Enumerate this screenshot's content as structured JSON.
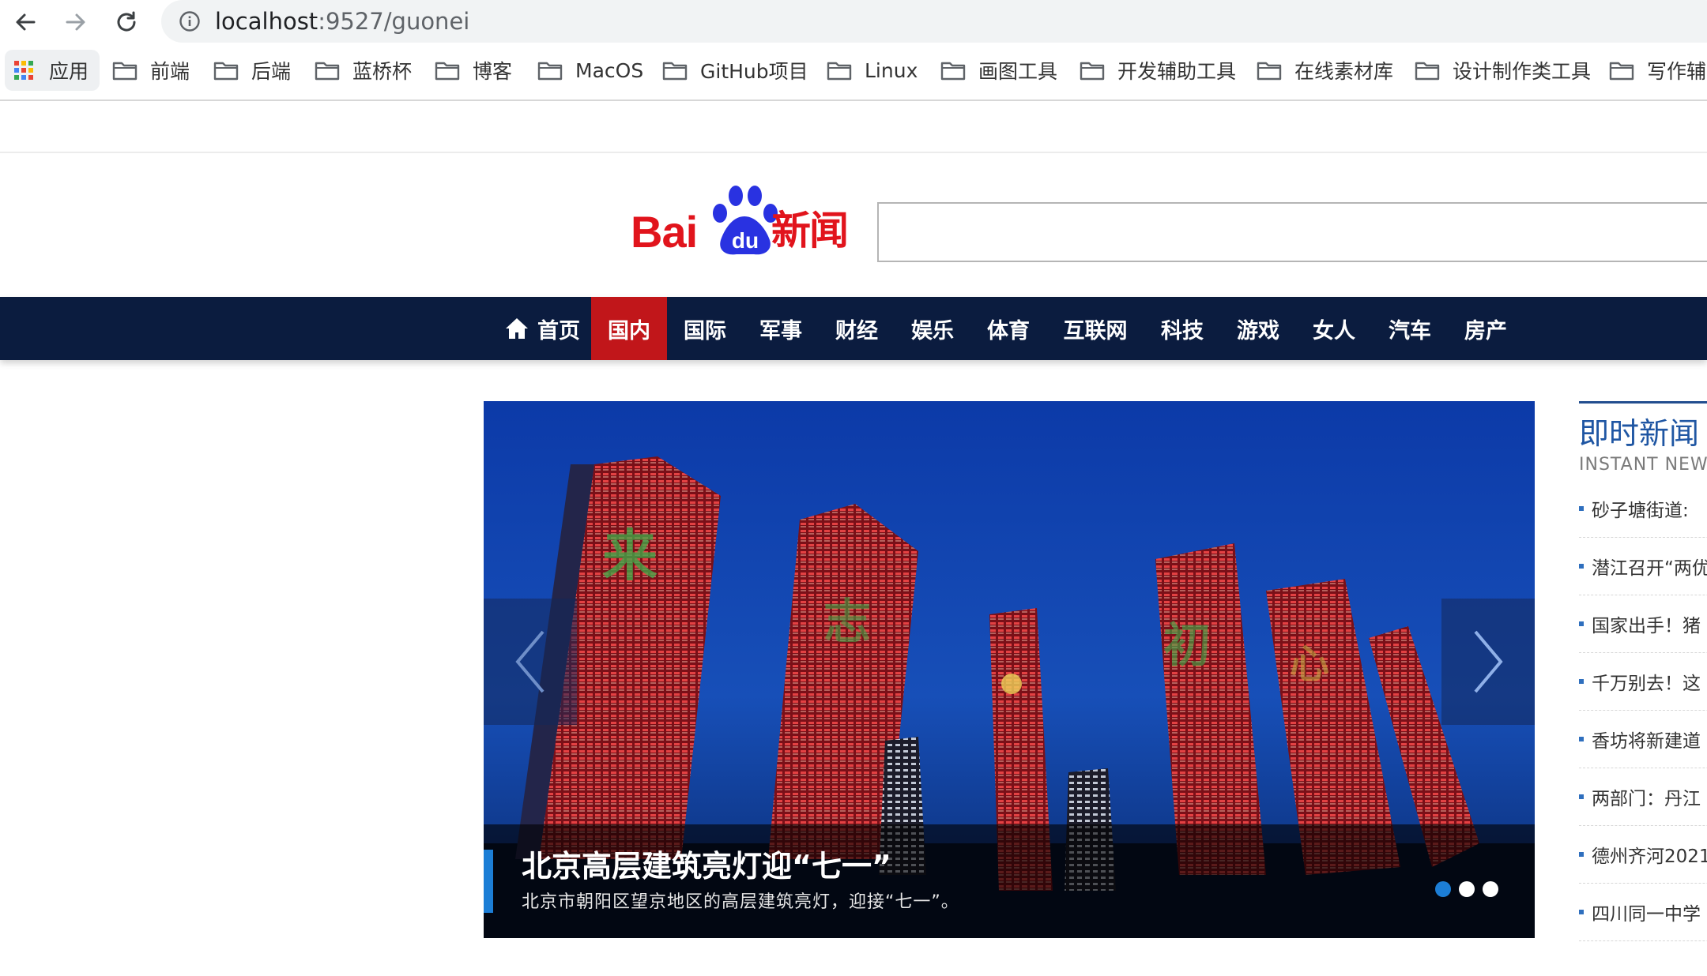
{
  "browser": {
    "url_host": "localhost",
    "url_path": ":9527/guonei",
    "bookmarks": {
      "apps_label": "应用",
      "items": [
        "前端",
        "后端",
        "蓝桥杯",
        "博客",
        "MacOS",
        "GitHub项目",
        "Linux",
        "画图工具",
        "开发辅助工具",
        "在线素材库",
        "设计制作类工具",
        "写作辅"
      ]
    },
    "icons": [
      "back-arrow-icon",
      "forward-arrow-icon",
      "reload-icon",
      "info-icon",
      "apps-grid-icon",
      "folder-icon"
    ]
  },
  "header": {
    "logo_bai": "Bai",
    "logo_du": "du",
    "logo_news": "新闻",
    "search_value": ""
  },
  "nav": {
    "items": [
      "首页",
      "国内",
      "国际",
      "军事",
      "财经",
      "娱乐",
      "体育",
      "互联网",
      "科技",
      "游戏",
      "女人",
      "汽车",
      "房产"
    ],
    "active": "国内",
    "colors": {
      "bar": "#0b1c3f",
      "active": "#c1161a"
    }
  },
  "carousel": {
    "title": "北京高层建筑亮灯迎“七一”",
    "subtitle": "北京市朝阳区望京地区的高层建筑亮灯，迎接“七一”。",
    "slide_count": 3,
    "active_slide": 1,
    "prev_icon": "chevron-left-icon",
    "next_icon": "chevron-right-icon"
  },
  "instant_news": {
    "title": "即时新闻",
    "subtitle": "INSTANT NEW",
    "items": [
      "砂子塘街道:",
      "潜江召开“两优",
      "国家出手！猪",
      "千万别去！这",
      "香坊将新建道",
      "两部门：丹江",
      "德州齐河2021",
      "四川同一中学"
    ]
  }
}
